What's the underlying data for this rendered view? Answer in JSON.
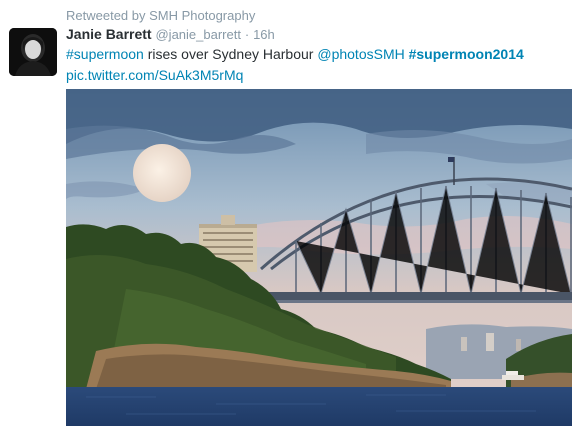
{
  "retweet": {
    "icon": "retweet-icon",
    "label": "Retweeted by SMH Photography"
  },
  "tweet": {
    "author_name": "Janie Barrett",
    "author_handle": "@janie_barrett",
    "separator": "·",
    "time": "16h",
    "hashtag1": "#supermoon",
    "text_mid": " rises over Sydney Harbour ",
    "mention": "@photosSMH",
    "hashtag2": "#supermoon2014",
    "pic_link": "pic.twitter.com/SuAk3M5rMq"
  },
  "colors": {
    "link": "#0084b4",
    "muted": "#8899a6",
    "text": "#292f33"
  }
}
